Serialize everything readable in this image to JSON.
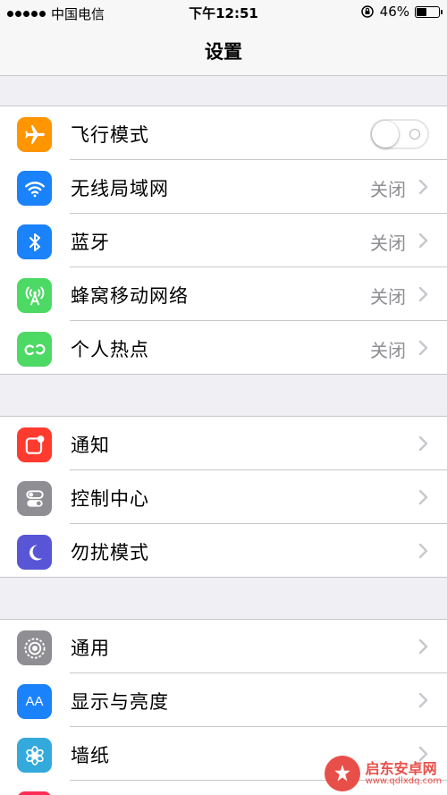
{
  "status_bar": {
    "carrier": "中国电信",
    "time": "下午12:51",
    "battery_text": "46%",
    "battery_level": 0.46,
    "signal_dots": 5
  },
  "nav": {
    "title": "设置"
  },
  "groups": {
    "network": [
      {
        "label": "飞行模式",
        "icon": "airplane-icon",
        "color": "#ff9500",
        "toggle": false
      },
      {
        "label": "无线局域网",
        "icon": "wifi-icon",
        "color": "#1a82fb",
        "value": "关闭"
      },
      {
        "label": "蓝牙",
        "icon": "bluetooth-icon",
        "color": "#1a82fb",
        "value": "关闭"
      },
      {
        "label": "蜂窝移动网络",
        "icon": "cellular-icon",
        "color": "#4cd964",
        "value": "关闭"
      },
      {
        "label": "个人热点",
        "icon": "hotspot-icon",
        "color": "#4cd964",
        "value": "关闭"
      }
    ],
    "system": [
      {
        "label": "通知",
        "icon": "notifications-icon",
        "color": "#ff3b30"
      },
      {
        "label": "控制中心",
        "icon": "control-center-icon",
        "color": "#8e8e93"
      },
      {
        "label": "勿扰模式",
        "icon": "moon-icon",
        "color": "#5856d6"
      }
    ],
    "device": [
      {
        "label": "通用",
        "icon": "gear-icon",
        "color": "#8e8e93"
      },
      {
        "label": "显示与亮度",
        "icon": "display-icon",
        "color": "#1a82fb",
        "icon_text": "AA"
      },
      {
        "label": "墙纸",
        "icon": "wallpaper-icon",
        "color": "#34aadc"
      }
    ]
  },
  "watermark": {
    "name": "启东安卓网",
    "url": "www.qdlxdq.com"
  }
}
